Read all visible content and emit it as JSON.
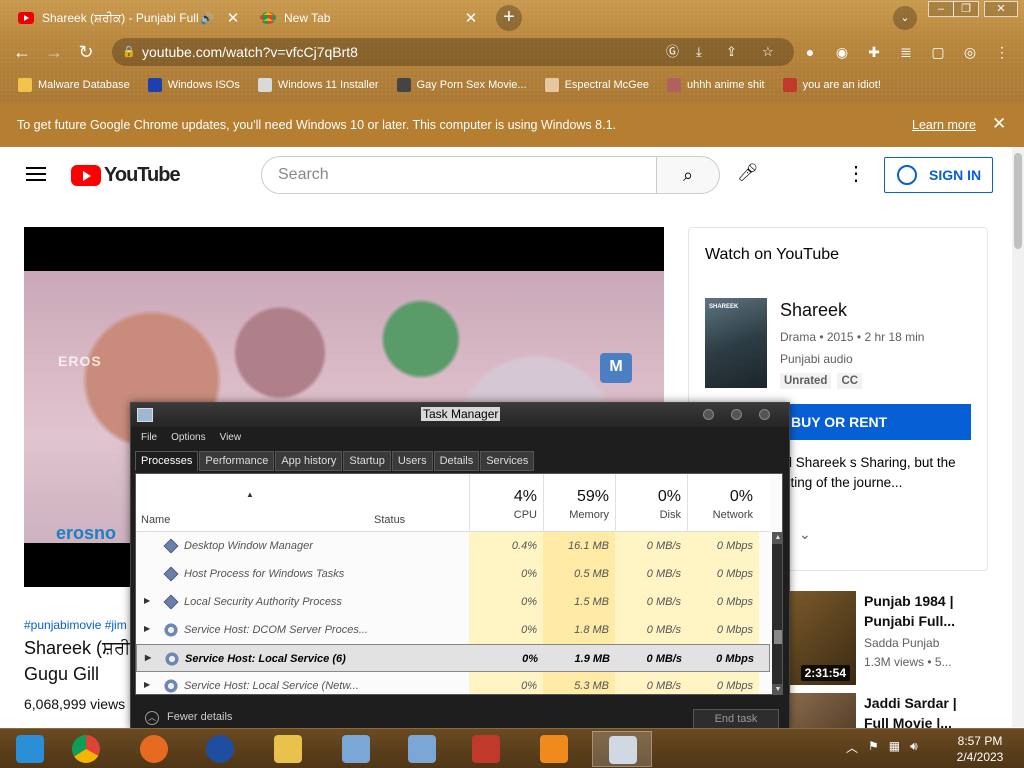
{
  "browser": {
    "tabs": [
      {
        "title": "Shareek (ਸ਼ਰੀਕ) - Punjabi Full",
        "active": true
      },
      {
        "title": "New Tab",
        "active": false
      }
    ],
    "new_tab_label": "+",
    "url": "youtube.com/watch?v=vfcCj7qBrt8",
    "bookmarks": [
      {
        "label": "Malware Database",
        "icon": "folder-icon",
        "color": "#f3c24d"
      },
      {
        "label": "Windows ISOs",
        "icon": "x-icon",
        "color": "#1f3fb0"
      },
      {
        "label": "Windows 11 Installer",
        "icon": "image-icon",
        "color": "#d9d9d9"
      },
      {
        "label": "Gay Porn Sex Movie...",
        "icon": "site-icon",
        "color": "#444444"
      },
      {
        "label": "Espectral McGee",
        "icon": "avatar-icon",
        "color": "#e6c8a0"
      },
      {
        "label": "uhhh anime shit",
        "icon": "anime-icon",
        "color": "#b06060"
      },
      {
        "label": "you are an idiot!",
        "icon": "flag-icon",
        "color": "#c0392b"
      }
    ],
    "infobar": {
      "message": "To get future Google Chrome updates, you'll need Windows 10 or later. This computer is using Windows 8.1.",
      "link": "Learn more"
    }
  },
  "youtube": {
    "logo_text": "YouTube",
    "search_placeholder": "Search",
    "sign_in": "SIGN IN",
    "video": {
      "watermark_tl": "EROS",
      "watermark_bl": "erosno",
      "tags": "#punjabimovie #jim",
      "title": "Shareek (ਸ਼ਰੀ Gugu Gill",
      "views": "6,068,999 views"
    },
    "watch_card": {
      "heading": "Watch on YouTube",
      "poster_text": "SHAREEK",
      "movie_name": "Shareek",
      "meta": "Drama • 2015 • 2 hr 18 min",
      "audio": "Punjabi audio",
      "badges": [
        "Unrated",
        "CC"
      ],
      "buy_button": "BUY OR RENT",
      "description": "says, the word Shareek s Sharing, but the film ory consisting of the journe..."
    },
    "recommendations": [
      {
        "title": "Punjab 1984 | Punjabi Full...",
        "channel": "Sadda Punjab",
        "views": "1.3M views • 5...",
        "duration": "2:31:54"
      },
      {
        "title": "Jaddi Sardar | Full Movie |...",
        "channel": "",
        "views": "",
        "duration": ""
      }
    ]
  },
  "task_manager": {
    "title": "Task Manager",
    "menu": [
      "File",
      "Options",
      "View"
    ],
    "tabs": [
      "Processes",
      "Performance",
      "App history",
      "Startup",
      "Users",
      "Details",
      "Services"
    ],
    "active_tab": "Processes",
    "columns": {
      "name": "Name",
      "status": "Status",
      "cpu": {
        "pct": "4%",
        "label": "CPU"
      },
      "memory": {
        "pct": "59%",
        "label": "Memory"
      },
      "disk": {
        "pct": "0%",
        "label": "Disk"
      },
      "network": {
        "pct": "0%",
        "label": "Network"
      }
    },
    "processes": [
      {
        "name": "Desktop Window Manager",
        "cpu": "0.4%",
        "mem": "16.1 MB",
        "disk": "0 MB/s",
        "net": "0 Mbps",
        "expand": false,
        "icon": "diamond",
        "selected": false
      },
      {
        "name": "Host Process for Windows Tasks",
        "cpu": "0%",
        "mem": "0.5 MB",
        "disk": "0 MB/s",
        "net": "0 Mbps",
        "expand": false,
        "icon": "diamond",
        "selected": false
      },
      {
        "name": "Local Security Authority Process",
        "cpu": "0%",
        "mem": "1.5 MB",
        "disk": "0 MB/s",
        "net": "0 Mbps",
        "expand": true,
        "icon": "diamond",
        "selected": false
      },
      {
        "name": "Service Host: DCOM Server Proces...",
        "cpu": "0%",
        "mem": "1.8 MB",
        "disk": "0 MB/s",
        "net": "0 Mbps",
        "expand": true,
        "icon": "gear",
        "selected": false
      },
      {
        "name": "Service Host: Local Service (6)",
        "cpu": "0%",
        "mem": "1.9 MB",
        "disk": "0 MB/s",
        "net": "0 Mbps",
        "expand": true,
        "icon": "gear",
        "selected": true
      },
      {
        "name": "Service Host: Local Service (Netw...",
        "cpu": "0%",
        "mem": "5.3 MB",
        "disk": "0 MB/s",
        "net": "0 Mbps",
        "expand": true,
        "icon": "gear",
        "selected": false
      }
    ],
    "fewer_details": "Fewer details",
    "end_task": "End task"
  },
  "taskbar": {
    "apps": [
      {
        "name": "start-button",
        "color": "#2a8fd6"
      },
      {
        "name": "chrome-app",
        "color": "#ffffff"
      },
      {
        "name": "firefox-app",
        "color": "#e66a1f"
      },
      {
        "name": "obama-logo-app",
        "color": "#1f4ea1"
      },
      {
        "name": "file-explorer-app",
        "color": "#e8c24d"
      },
      {
        "name": "network-app-1",
        "color": "#7aa7d6"
      },
      {
        "name": "network-app-2",
        "color": "#7aa7d6"
      },
      {
        "name": "red-app",
        "color": "#c0392b"
      },
      {
        "name": "vlc-app",
        "color": "#f08a1c"
      },
      {
        "name": "task-manager-app",
        "color": "#cfd8e3"
      }
    ],
    "time": "8:57 PM",
    "date": "2/4/2023"
  }
}
